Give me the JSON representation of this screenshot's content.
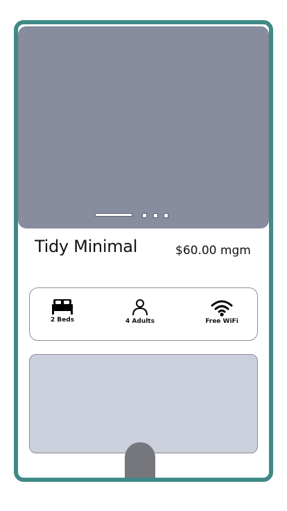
{
  "listing": {
    "title": "Tidy Minimal",
    "price": "$60.00 mgm"
  },
  "carousel": {
    "total_slides": 4,
    "active_index": 0
  },
  "amenities": [
    {
      "icon": "bed-icon",
      "label": "2 Beds"
    },
    {
      "icon": "person-icon",
      "label": "4 Adults"
    },
    {
      "icon": "wifi-icon",
      "label": "Free WiFi"
    }
  ],
  "colors": {
    "frame": "#3f8a87",
    "hero": "#878c9f",
    "details_panel": "#cbd0dc",
    "bottom_tab": "#75777c"
  }
}
